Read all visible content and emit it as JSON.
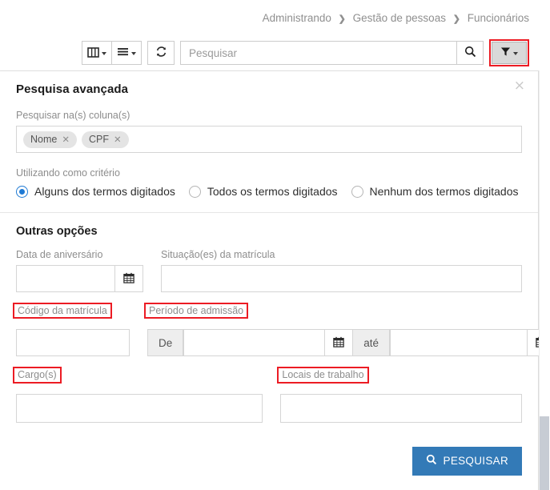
{
  "breadcrumb": {
    "items": [
      "Administrando",
      "Gestão de pessoas",
      "Funcionários"
    ],
    "separator": "❯"
  },
  "toolbar": {
    "columns_button_icon": "columns-icon",
    "list_button_icon": "list-icon",
    "refresh_button_icon": "refresh-icon",
    "search": {
      "placeholder": "Pesquisar",
      "value": ""
    },
    "search_icon": "search-icon",
    "filter_button": {
      "icon": "filter-icon",
      "active": true,
      "highlight_color": "#ec1c24"
    }
  },
  "panel": {
    "title": "Pesquisa avançada",
    "close_label": "×",
    "columns_field": {
      "label": "Pesquisar na(s) coluna(s)",
      "tags": [
        {
          "label": "Nome",
          "remove": "✕"
        },
        {
          "label": "CPF",
          "remove": "✕"
        }
      ]
    },
    "criteria": {
      "label": "Utilizando como critério",
      "options": [
        {
          "label": "Alguns dos termos digitados",
          "selected": true
        },
        {
          "label": "Todos os termos digitados",
          "selected": false
        },
        {
          "label": "Nenhum dos termos digitados",
          "selected": false
        }
      ]
    },
    "other_options": {
      "title": "Outras opções",
      "birthday": {
        "label": "Data de aniversário",
        "value": "",
        "calendar_icon": "calendar-icon",
        "highlighted": false
      },
      "enrollment_status": {
        "label": "Situação(es) da matrícula",
        "value": "",
        "highlighted": false
      },
      "enrollment_code": {
        "label": "Código da matrícula",
        "value": "",
        "highlighted": true
      },
      "admission_period": {
        "label": "Período de admissão",
        "highlighted": true,
        "from_addon": "De",
        "from_value": "",
        "to_addon": "até",
        "to_value": "",
        "calendar_icon": "calendar-icon"
      },
      "roles": {
        "label": "Cargo(s)",
        "value": "",
        "highlighted": true
      },
      "workplaces": {
        "label": "Locais de trabalho",
        "value": "",
        "highlighted": true
      }
    },
    "submit": {
      "label": "PESQUISAR",
      "icon": "search-icon",
      "color": "#337ab7"
    }
  },
  "scrollbar": {
    "orientation": "vertical"
  }
}
